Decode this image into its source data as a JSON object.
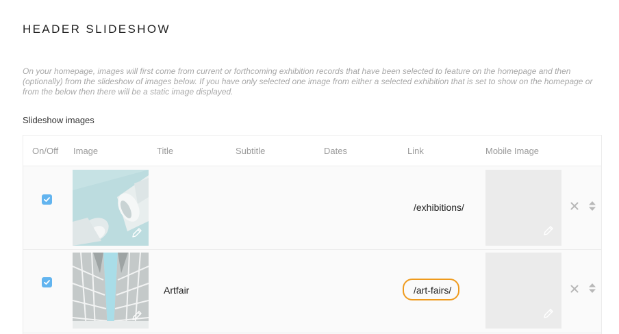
{
  "header": {
    "title": "HEADER SLIDESHOW"
  },
  "intro": {
    "text": "On your homepage, images will first come from current or forthcoming exhibition records that have been selected to feature on the homepage and then (optionally) from the slideshow of images below. If you have only selected one image from either a selected exhibition that is set to show on the homepage or from the below then there will be a static image displayed."
  },
  "slideshow": {
    "label": "Slideshow images",
    "columns": [
      "On/Off",
      "Image",
      "Title",
      "Subtitle",
      "Dates",
      "Link",
      "Mobile Image"
    ],
    "rows": [
      {
        "enabled": true,
        "image": "abstract-architecture-photo",
        "title": "",
        "subtitle": "",
        "dates": "",
        "link": "/exhibitions/",
        "mobile_image": "empty"
      },
      {
        "enabled": true,
        "image": "symmetric-building-photo",
        "title": "Artfair",
        "subtitle": "",
        "dates": "",
        "link": "/art-fairs/",
        "mobile_image": "empty",
        "link_highlighted": true
      }
    ]
  },
  "colors": {
    "accent": "#62b4ef",
    "highlight": "#ef9a1c",
    "muted_text": "#a8a8a8"
  },
  "icons": {
    "edit": "pencil-icon",
    "remove": "close-icon",
    "reorder": "sort-icon",
    "check": "checkmark-icon"
  }
}
